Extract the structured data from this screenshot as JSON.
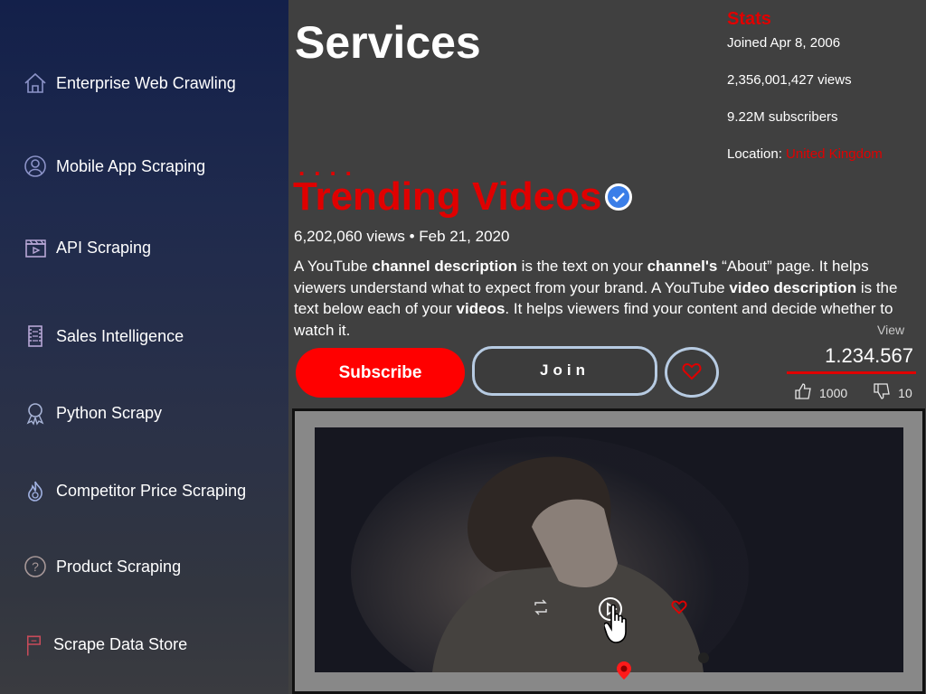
{
  "sidebar": {
    "items": [
      {
        "label": "Enterprise Web Crawling",
        "icon": "home-icon"
      },
      {
        "label": "Mobile App Scraping",
        "icon": "user-circle-icon"
      },
      {
        "label": "API Scraping",
        "icon": "clapperboard-icon"
      },
      {
        "label": "Sales Intelligence",
        "icon": "film-strip-icon"
      },
      {
        "label": "Python Scrapy",
        "icon": "award-ribbon-icon"
      },
      {
        "label": "Competitor Price Scraping",
        "icon": "fire-icon"
      },
      {
        "label": "Product Scraping",
        "icon": "question-icon"
      },
      {
        "label": "Scrape Data Store",
        "icon": "flag-icon"
      }
    ]
  },
  "main": {
    "title": "Services",
    "dots": "....",
    "trending_title": "Trending Videos",
    "views_date": "6,202,060 views • Feb 21, 2020",
    "description": {
      "p1": "A YouTube ",
      "b1": "channel description",
      "p2": " is the text on your ",
      "b2": "channel's",
      "p3": " “About” page. It helps viewers understand what to expect from your brand. A YouTube ",
      "b3": "video description",
      "p4": " is the text below each of your ",
      "b4": "videos",
      "p5": ". It helps viewers find your content and decide whether to watch it."
    },
    "subscribe_label": "Subscribe",
    "join_label": "Join"
  },
  "stats": {
    "title": "Stats",
    "joined": "Joined Apr 8, 2006",
    "views": "2,356,001,427 views",
    "subscribers": "9.22M subscribers",
    "location_label": "Location: ",
    "location_value": "United Kingdom"
  },
  "view_panel": {
    "label": "View",
    "count": "1.234.567",
    "likes": "1000",
    "dislikes": "10"
  },
  "colors": {
    "accent": "#e00000",
    "button_red": "#ff0000",
    "outline_blue": "#b7cbe2"
  }
}
